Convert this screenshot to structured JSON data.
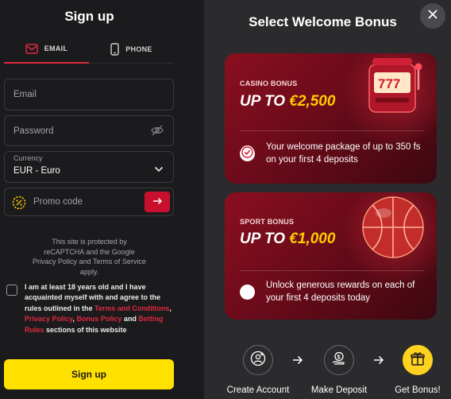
{
  "signup": {
    "title": "Sign up",
    "tabs": [
      {
        "label": "EMAIL",
        "icon": "mail-icon",
        "active": true
      },
      {
        "label": "PHONE",
        "icon": "phone-icon",
        "active": false
      }
    ],
    "email_placeholder": "Email",
    "password_placeholder": "Password",
    "currency_label": "Currency",
    "currency_value": "EUR - Euro",
    "promo_placeholder": "Promo code",
    "recaptcha_text": "This site is protected by reCAPTCHA and the Google Privacy Policy and Terms of Service apply.",
    "agree": {
      "t1": "I am at least 18 years old and I have acquainted myself with and agree to the rules outlined in the ",
      "link1": "Terms and Conditions",
      "t2": ", ",
      "link2": "Privacy Policy",
      "t3": ", ",
      "link3": "Bonus Policy",
      "t4": " and ",
      "link4": "Betting Rules",
      "t5": " sections of this website"
    },
    "button": "Sign up"
  },
  "bonus": {
    "title": "Select Welcome Bonus",
    "cards": [
      {
        "tag": "CASINO BONUS",
        "prefix": "UP TO ",
        "amount": "€2,500",
        "description": "Your welcome package of up to 350 fs on your first 4 deposits",
        "selected": true
      },
      {
        "tag": "SPORT BONUS",
        "prefix": "UP TO ",
        "amount": "€1,000",
        "description": "Unlock generous rewards on each of your first 4 deposits today",
        "selected": false
      }
    ],
    "steps": [
      {
        "label": "Create Account",
        "icon": "user-plus-icon"
      },
      {
        "label": "Make Deposit",
        "icon": "coin-hand-icon"
      },
      {
        "label": "Get Bonus!",
        "icon": "gift-icon"
      }
    ]
  },
  "colors": {
    "accent_red": "#e0283e",
    "button_yellow": "#ffe100",
    "gold": "#ffcc00"
  }
}
